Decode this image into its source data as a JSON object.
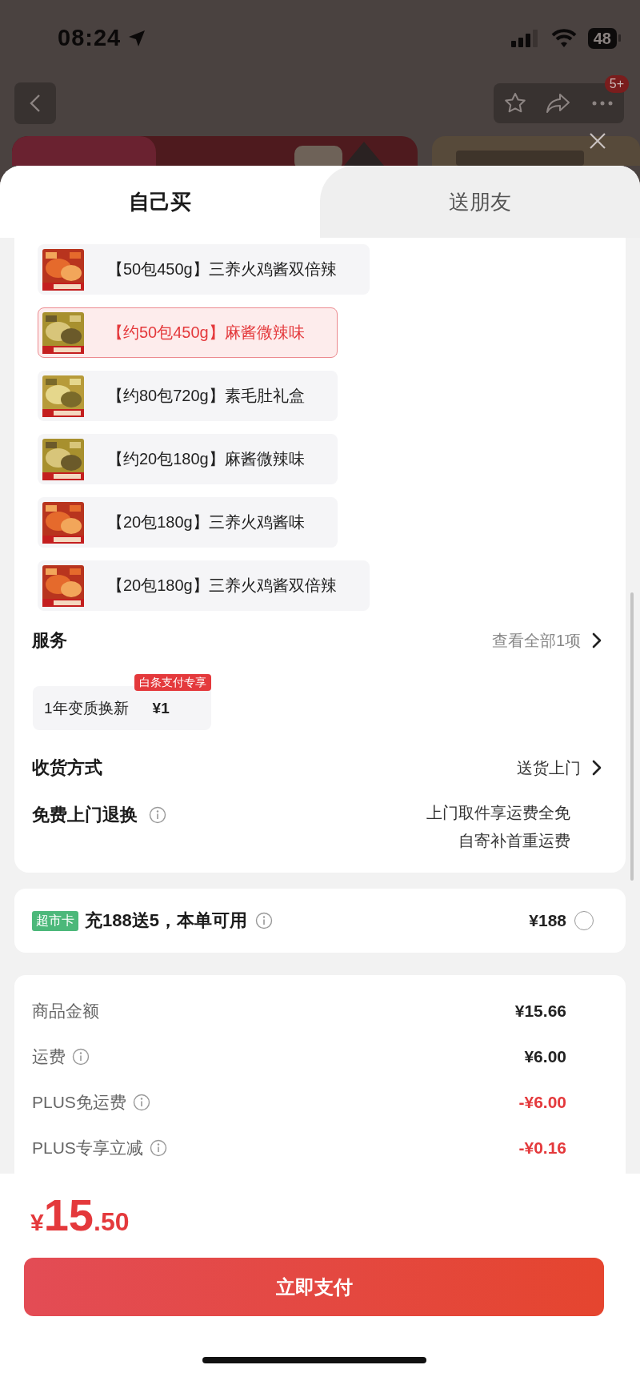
{
  "status_bar": {
    "time": "08:24",
    "battery": "48"
  },
  "nav": {
    "badge": "5+"
  },
  "tabs": [
    {
      "label": "自己买",
      "selected": true
    },
    {
      "label": "送朋友",
      "selected": false
    }
  ],
  "options": [
    {
      "label": "【50包450g】三养火鸡酱双倍辣",
      "selected": false
    },
    {
      "label": "【约50包450g】麻酱微辣味",
      "selected": true
    },
    {
      "label": "【约80包720g】素毛肚礼盒",
      "selected": false
    },
    {
      "label": "【约20包180g】麻酱微辣味",
      "selected": false
    },
    {
      "label": "【20包180g】三养火鸡酱味",
      "selected": false
    },
    {
      "label": "【20包180g】三养火鸡酱双倍辣",
      "selected": false
    }
  ],
  "service": {
    "title": "服务",
    "link": "查看全部1项",
    "items": [
      {
        "label": "1年变质换新",
        "price": "¥1",
        "badge": "白条支付专享"
      }
    ]
  },
  "delivery": {
    "label": "收货方式",
    "value": "送货上门"
  },
  "returns": {
    "label": "免费上门退换",
    "lines": [
      "上门取件享运费全免",
      "自寄补首重运费"
    ]
  },
  "card_offer": {
    "tag": "超市卡",
    "text": "充188送5，本单可用",
    "price": "¥188",
    "checked": false
  },
  "summary": [
    {
      "label": "商品金额",
      "value": "¥15.66",
      "info": false,
      "discount": false
    },
    {
      "label": "运费",
      "value": "¥6.00",
      "info": true,
      "discount": false
    },
    {
      "label": "PLUS免运费",
      "value": "-¥6.00",
      "info": true,
      "discount": true
    },
    {
      "label": "PLUS专享立减",
      "value": "-¥0.16",
      "info": true,
      "discount": true
    }
  ],
  "total": {
    "currency": "¥",
    "integer": "15",
    "decimal": ".50"
  },
  "pay_button": "立即支付"
}
